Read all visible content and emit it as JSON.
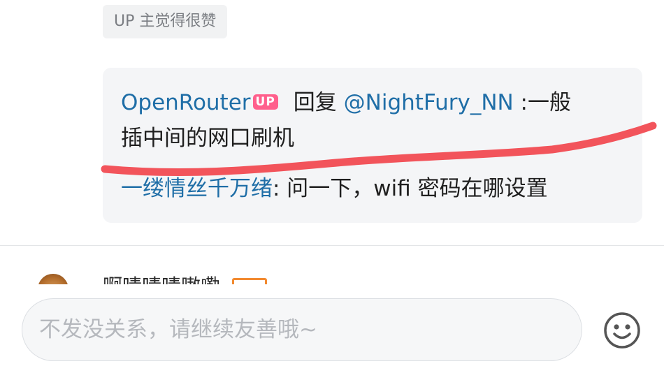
{
  "up_liked_tag": "UP 主觉得很赞",
  "reply": {
    "author": "OpenRouter",
    "author_badge": "UP",
    "reply_word": "回复",
    "mention": "@NightFury_NN",
    "text_line1": " :一般",
    "text_line2": "插中间的网口刷机",
    "sub_reply_author": "一缕情丝千万绪",
    "sub_reply_text": ": 问一下，wifi 密码在哪设置"
  },
  "next_comment": {
    "username": "啊啧啧啧嗷嘞"
  },
  "comment_bar": {
    "placeholder": "不发没关系，请继续友善哦~"
  },
  "colors": {
    "link_blue": "#1f6ea7",
    "up_badge_pink": "#ff5f8c",
    "annotation_red": "#f2545b"
  },
  "icons": {
    "emoji": "smiley-face-icon",
    "annotation": "red-underline-annotation"
  }
}
